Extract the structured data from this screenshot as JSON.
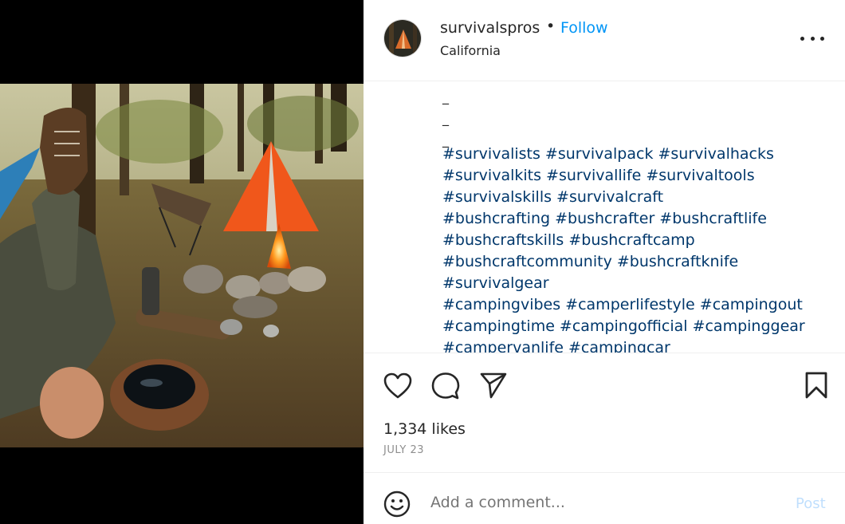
{
  "post": {
    "username": "survivalspros",
    "separator": "•",
    "follow_label": "Follow",
    "location": "California",
    "caption_dashes": [
      "_",
      "_",
      "_"
    ],
    "hashtag_lines": [
      "#survivalists #survivalpack #survivalhacks",
      "#survivalkits #survivallife #survivaltools",
      "#survivalskills #survivalcraft",
      "#bushcrafting #bushcrafter #bushcraftlife",
      "#bushcraftskills #bushcraftcamp",
      "#bushcraftcommunity #bushcraftknife",
      "#survivalgear",
      "#campingvibes #camperlifestyle #campingout",
      "#campingtime #campingofficial #campinggear",
      "#campervanlife #campingcar"
    ],
    "likes": "1,334 likes",
    "date": "JULY 23"
  },
  "comment": {
    "placeholder": "Add a comment...",
    "post_label": "Post"
  },
  "icons": {
    "like": "heart-icon",
    "comment": "comment-bubble-icon",
    "share": "paper-plane-icon",
    "save": "bookmark-icon",
    "emoji": "smiley-icon",
    "more": "more-options-icon"
  },
  "colors": {
    "link": "#0095f6",
    "hashtag": "#00376b",
    "muted": "#8e8e8e",
    "post_disabled": "#c0dffd"
  }
}
